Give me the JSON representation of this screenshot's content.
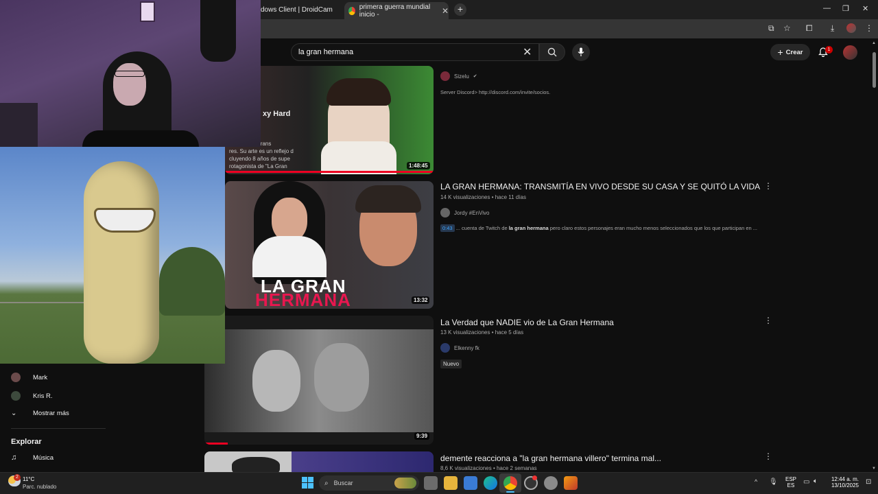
{
  "browser": {
    "tabs": [
      {
        "label": "dows Client | DroidCam"
      },
      {
        "label": "primera guerra mundial inicio -"
      }
    ],
    "new_tab": "+",
    "window_controls": [
      "—",
      "❐",
      "✕"
    ]
  },
  "youtube": {
    "search": {
      "value": "la gran hermana"
    },
    "create_label": "Crear",
    "notification_count": "1"
  },
  "videos": [
    {
      "duration": "1:48:45",
      "thumb_text": "xy Hard",
      "thumb_caption": "ética, mujer trans\nres. Su arte es un reflejo d\ncluyendo 8 años de supe\nrotagonista de \"La Gran",
      "channel": "Sizelu",
      "verified": "✔",
      "description": "Server Discord> http://discord.com/invite/socios."
    },
    {
      "title": "LA GRAN HERMANA: TRANSMITÍA EN VIVO DESDE SU CASA Y SE QUITÓ LA VIDA",
      "views": "14 K visualizaciones",
      "age": "hace 11 días",
      "channel": "Jordy #EnVivo",
      "duration": "13:32",
      "thumb_line1": "LA GRAN",
      "thumb_line2": "HERMANA",
      "chapter_time": "0:43",
      "desc_before": "... cuenta de Twitch de ",
      "desc_bold": "la gran hermana",
      "desc_after": " pero claro estos personajes eran mucho menos seleccionados que los que participan en ..."
    },
    {
      "title": "La Verdad que NADIE vio de La Gran Hermana",
      "views": "13 K visualizaciones",
      "age": "hace 5 días",
      "channel": "Elkenny fk",
      "badge": "Nuevo",
      "duration": "9:39"
    },
    {
      "title": "demente reacciona a \"la gran hermana villero\" termina mal...",
      "views": "8,6 K visualizaciones",
      "age": "hace 2 semanas"
    }
  ],
  "sidebar": {
    "subs": [
      {
        "label": "Mark"
      },
      {
        "label": "Kris R."
      }
    ],
    "more_label": "Mostrar más",
    "explore_heading": "Explorar",
    "explore_items": [
      {
        "label": "Música"
      }
    ]
  },
  "taskbar": {
    "weather_temp": "11°C",
    "weather_desc": "Parc. nublado",
    "search_placeholder": "Buscar",
    "lang_top": "ESP",
    "lang_bottom": "ES",
    "time": "12:44 a. m.",
    "date": "13/10/2025",
    "notif_badge": "2"
  }
}
